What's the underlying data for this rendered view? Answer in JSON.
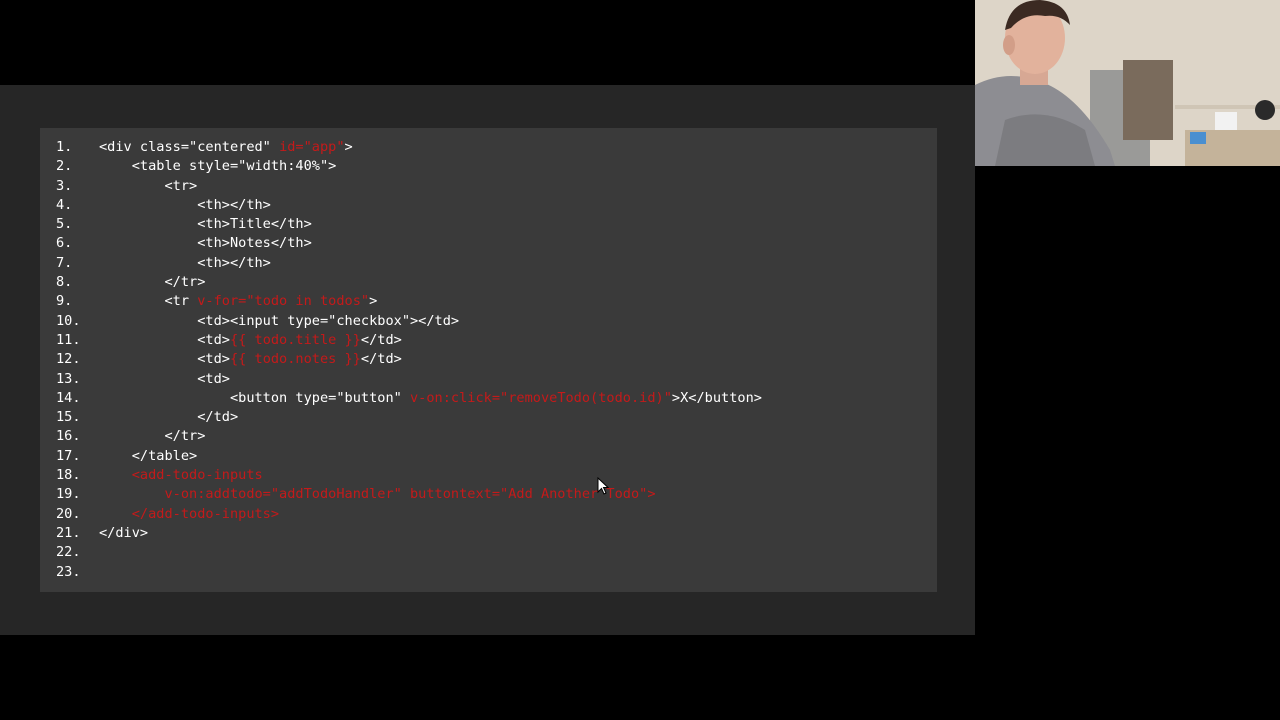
{
  "code": {
    "lines": [
      {
        "n": "1.",
        "parts": [
          {
            "t": "<div class=\"centered\" ",
            "c": "w"
          },
          {
            "t": "id=\"app\"",
            "c": "r"
          },
          {
            "t": ">",
            "c": "w"
          }
        ]
      },
      {
        "n": "2.",
        "parts": [
          {
            "t": "    <table style=\"width:40%\">",
            "c": "w"
          }
        ]
      },
      {
        "n": "3.",
        "parts": [
          {
            "t": "        <tr>",
            "c": "w"
          }
        ]
      },
      {
        "n": "4.",
        "parts": [
          {
            "t": "            <th></th>",
            "c": "w"
          }
        ]
      },
      {
        "n": "5.",
        "parts": [
          {
            "t": "            <th>Title</th>",
            "c": "w"
          }
        ]
      },
      {
        "n": "6.",
        "parts": [
          {
            "t": "            <th>Notes</th>",
            "c": "w"
          }
        ]
      },
      {
        "n": "7.",
        "parts": [
          {
            "t": "            <th></th>",
            "c": "w"
          }
        ]
      },
      {
        "n": "8.",
        "parts": [
          {
            "t": "        </tr>",
            "c": "w"
          }
        ]
      },
      {
        "n": "9.",
        "parts": [
          {
            "t": "        <tr ",
            "c": "w"
          },
          {
            "t": "v-for=\"todo in todos\"",
            "c": "r"
          },
          {
            "t": ">",
            "c": "w"
          }
        ]
      },
      {
        "n": "10.",
        "parts": [
          {
            "t": "            <td><input type=\"checkbox\"></td>",
            "c": "w"
          }
        ]
      },
      {
        "n": "11.",
        "parts": [
          {
            "t": "            <td>",
            "c": "w"
          },
          {
            "t": "{{ todo.title }}",
            "c": "r"
          },
          {
            "t": "</td>",
            "c": "w"
          }
        ]
      },
      {
        "n": "12.",
        "parts": [
          {
            "t": "            <td>",
            "c": "w"
          },
          {
            "t": "{{ todo.notes }}",
            "c": "r"
          },
          {
            "t": "</td>",
            "c": "w"
          }
        ]
      },
      {
        "n": "13.",
        "parts": [
          {
            "t": "            <td>",
            "c": "w"
          }
        ]
      },
      {
        "n": "14.",
        "parts": [
          {
            "t": "                <button type=\"button\" ",
            "c": "w"
          },
          {
            "t": "v-on:click=\"removeTodo(todo.id)\"",
            "c": "r"
          },
          {
            "t": ">X</button>",
            "c": "w"
          }
        ]
      },
      {
        "n": "15.",
        "parts": [
          {
            "t": "            </td>",
            "c": "w"
          }
        ]
      },
      {
        "n": "16.",
        "parts": [
          {
            "t": "        </tr>",
            "c": "w"
          }
        ]
      },
      {
        "n": "17.",
        "parts": [
          {
            "t": "    </table>",
            "c": "w"
          }
        ]
      },
      {
        "n": "18.",
        "parts": [
          {
            "t": "    <add-todo-inputs",
            "c": "r"
          }
        ]
      },
      {
        "n": "19.",
        "parts": [
          {
            "t": "        v-on:addtodo=\"addTodoHandler\" buttontext=\"Add Another Todo\">",
            "c": "r"
          }
        ]
      },
      {
        "n": "20.",
        "parts": [
          {
            "t": "    </add-todo-inputs>",
            "c": "r"
          }
        ]
      },
      {
        "n": "21.",
        "parts": [
          {
            "t": "</div>",
            "c": "w"
          }
        ]
      },
      {
        "n": "22.",
        "parts": []
      },
      {
        "n": "23.",
        "parts": []
      }
    ]
  },
  "colors": {
    "background": "#000000",
    "slide": "#262626",
    "code_panel": "#3a3a3a",
    "code_text": "#ffffff",
    "highlight": "#c41a1a"
  },
  "icons": {
    "cursor": "mouse-pointer-icon",
    "webcam": "presenter-webcam"
  }
}
